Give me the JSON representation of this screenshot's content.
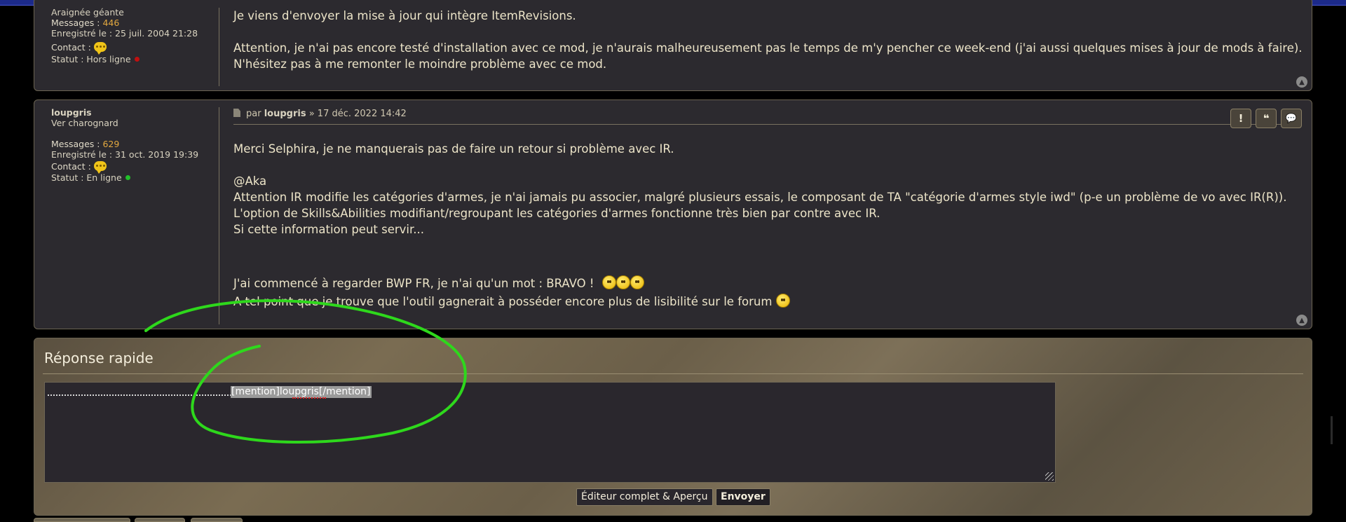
{
  "colors": {
    "accent": "#e2a840",
    "online": "#22c02a",
    "offline": "#c01010",
    "annotation": "#2ed81c"
  },
  "post1": {
    "author_rank": "Araignée géante",
    "messages_label": "Messages :",
    "messages_count": "446",
    "registered": "Enregistré le : 25 juil. 2004 21:28",
    "contact_label": "Contact :",
    "status": "Statut : Hors ligne",
    "lines": [
      "Je viens d'envoyer la mise à jour qui intègre ItemRevisions.",
      "",
      "Attention, je n'ai pas encore testé d'installation avec ce mod, je n'aurais malheureusement pas le temps de m'y pencher ce week-end (j'ai aussi quelques mises à jour de mods à faire).",
      "N'hésitez pas à me remonter le moindre problème avec ce mod."
    ]
  },
  "post2": {
    "author": "loupgris",
    "author_rank": "Ver charognard",
    "messages_label": "Messages :",
    "messages_count": "629",
    "registered": "Enregistré le : 31 oct. 2019 19:39",
    "contact_label": "Contact :",
    "status": "Statut : En ligne",
    "meta_prefix": "par",
    "meta_author": "loupgris",
    "meta_date": "» 17 déc. 2022 14:42",
    "actions": [
      "!",
      "❝",
      "💬"
    ],
    "lines": [
      "Merci Selphira, je ne manquerais pas de faire un retour si problème avec IR.",
      "",
      "@Aka",
      "Attention IR modifie les catégories d'armes, je n'ai jamais pu associer, malgré plusieurs essais, le composant de TA \"catégorie d'armes style iwd\" (p-e un problème de vo avec IR(R)).",
      "L'option de Skills&Abilities modifiant/regroupant les catégories d'armes fonctionne très bien par contre avec IR.",
      "Si cette information peut servir...",
      "",
      "",
      ""
    ],
    "bravo_line": "J'ai commencé à regarder BWP FR, je n'ai qu'un mot : BRAVO !",
    "last_line": "A tel point que je trouve que l'outil gagnerait à posséder encore plus de lisibilité sur le forum"
  },
  "quick_reply": {
    "title": "Réponse rapide",
    "textarea_value": "[mention]loupgris[/mention]",
    "full_editor_button": "Éditeur complet & Aperçu",
    "send_button": "Envoyer"
  },
  "icons": {
    "contact": "speech-bubble-icon",
    "back_to_top": "chevron-up-icon",
    "post": "document-icon"
  }
}
